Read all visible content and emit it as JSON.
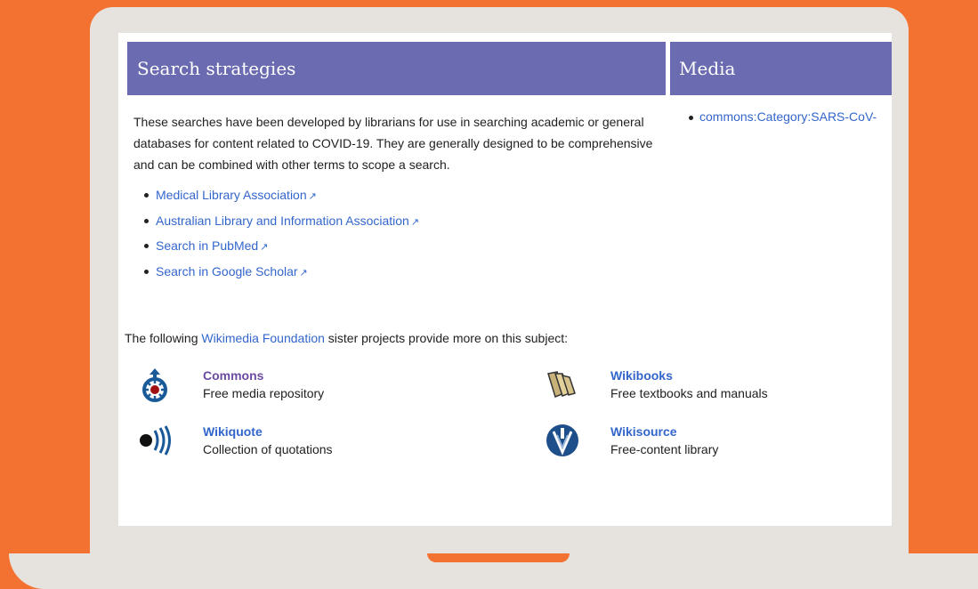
{
  "search_strategies": {
    "heading": "Search strategies",
    "intro": "These searches have been developed by librarians for use in searching academic or general databases for content related to COVID-19. They are generally designed to be comprehensive and can be combined with other terms to scope a search.",
    "links": [
      {
        "label": "Medical Library Association"
      },
      {
        "label": "Australian Library and Information Association"
      },
      {
        "label": "Search in PubMed"
      },
      {
        "label": "Search in Google Scholar"
      }
    ]
  },
  "media": {
    "heading": "Media",
    "items": [
      {
        "label": "commons:Category:SARS-CoV-"
      }
    ]
  },
  "sister_projects": {
    "intro_before": "The following ",
    "intro_link": "Wikimedia Foundation",
    "intro_after": " sister projects provide more on this subject:",
    "projects": [
      {
        "name": "Commons",
        "desc": "Free media repository",
        "icon": "commons-icon"
      },
      {
        "name": "Wikibooks",
        "desc": "Free textbooks and manuals",
        "icon": "wikibooks-icon"
      },
      {
        "name": "Wikiquote",
        "desc": "Collection of quotations",
        "icon": "wikiquote-icon"
      },
      {
        "name": "Wikisource",
        "desc": "Free-content library",
        "icon": "wikisource-icon"
      }
    ]
  },
  "colors": {
    "background": "#f47231",
    "header": "#6b6bb2",
    "link": "#3366cc",
    "visited_link": "#6b4ba1",
    "bezel": "#e6e3df"
  }
}
